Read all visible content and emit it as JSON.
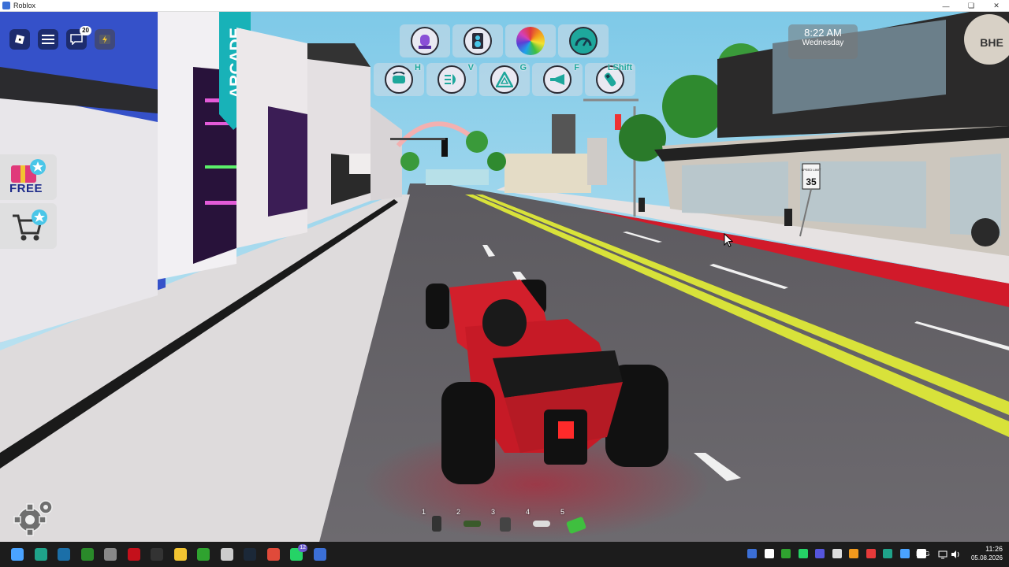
{
  "window": {
    "title": "Roblox",
    "controls": [
      "minimize-icon",
      "maximize-icon",
      "close-icon"
    ]
  },
  "hud": {
    "top_left": {
      "roblox_menu_icon": "roblox-logo-icon",
      "menu_icon": "hamburger-icon",
      "chat_badge": "20",
      "chat_icon": "chat-icon",
      "extra_icon": "lightning-icon"
    },
    "side_buttons": [
      {
        "name": "free-gift-button",
        "label": "FREE",
        "icon": "gift-star-icon"
      },
      {
        "name": "shop-button",
        "label": "",
        "icon": "cart-star-icon"
      }
    ],
    "vehicle_toolbar_row1": [
      {
        "name": "siren-button",
        "icon": "siren-icon",
        "color": "#8a4fd6"
      },
      {
        "name": "speaker-button",
        "icon": "speaker-icon",
        "color": "#2b2b3a"
      },
      {
        "name": "color-wheel-button",
        "icon": "color-wheel-icon",
        "color": "#f0b000"
      },
      {
        "name": "speedometer-button",
        "icon": "speedometer-icon",
        "color": "#1ea79c"
      }
    ],
    "vehicle_toolbar_row2": [
      {
        "name": "hazard-flip-button",
        "icon": "car-flip-icon",
        "key": "H"
      },
      {
        "name": "headlights-button",
        "icon": "headlight-icon",
        "key": "V"
      },
      {
        "name": "hazard-lights-button",
        "icon": "hazard-triangle-icon",
        "key": "G"
      },
      {
        "name": "horn-button",
        "icon": "horn-icon",
        "key": "F"
      },
      {
        "name": "boost-button",
        "icon": "nitro-icon",
        "key": "LShift"
      }
    ],
    "clock": {
      "time": "8:22 AM",
      "day": "Wednesday"
    },
    "hotbar": [
      {
        "slot": "1",
        "icon": "phone-icon",
        "color": "#333333"
      },
      {
        "slot": "2",
        "icon": "tool-icon",
        "color": "#3a5a2a"
      },
      {
        "slot": "3",
        "icon": "card-icon",
        "color": "#444444"
      },
      {
        "slot": "4",
        "icon": "car-key-icon",
        "color": "#dddddd"
      },
      {
        "slot": "5",
        "icon": "cash-icon",
        "color": "#3fbf3f"
      }
    ],
    "settings_icon": "gear-icon"
  },
  "scene": {
    "storefront_sign": "ARCADE",
    "speed_limit_sign_title": "SPEED LIMIT",
    "speed_limit_sign_value": "35",
    "building_logo": "BHE"
  },
  "taskbar": {
    "apps": [
      {
        "name": "start",
        "icon": "windows-icon",
        "color": "#4aa3ff"
      },
      {
        "name": "edge",
        "icon": "edge-icon",
        "color": "#1fa38a"
      },
      {
        "name": "app3",
        "icon": "bookmark-icon",
        "color": "#1b6fa8"
      },
      {
        "name": "xbox",
        "icon": "xbox-icon",
        "color": "#2a8a2a"
      },
      {
        "name": "app5",
        "icon": "steam-like-icon",
        "color": "#888888"
      },
      {
        "name": "netflix",
        "icon": "netflix-icon",
        "color": "#c4101b"
      },
      {
        "name": "epic",
        "icon": "epic-games-icon",
        "color": "#333333"
      },
      {
        "name": "explorer",
        "icon": "folder-icon",
        "color": "#f2c431"
      },
      {
        "name": "xbox2",
        "icon": "xbox-icon",
        "color": "#2fa32f"
      },
      {
        "name": "app10",
        "icon": "target-icon",
        "color": "#cccccc"
      },
      {
        "name": "steam",
        "icon": "steam-icon",
        "color": "#1b2838"
      },
      {
        "name": "chrome",
        "icon": "chrome-icon",
        "color": "#e04a3a"
      },
      {
        "name": "whatsapp",
        "icon": "whatsapp-icon",
        "color": "#25d366"
      },
      {
        "name": "roblox",
        "icon": "roblox-icon",
        "color": "#3b6fd6"
      }
    ],
    "whatsapp_badge": "12",
    "tray_icons": [
      {
        "icon": "roblox-tray-icon",
        "color": "#3b6fd6"
      },
      {
        "icon": "tray-app-icon",
        "color": "#ffffff"
      },
      {
        "icon": "xbox-tray-icon",
        "color": "#2fa32f"
      },
      {
        "icon": "whatsapp-tray-icon",
        "color": "#25d366"
      },
      {
        "icon": "tray-app2-icon",
        "color": "#5555dd"
      },
      {
        "icon": "tray-app3-icon",
        "color": "#dddddd"
      },
      {
        "icon": "tray-app4-icon",
        "color": "#f29a1c"
      },
      {
        "icon": "tray-app5-icon",
        "color": "#e63a3a"
      },
      {
        "icon": "tray-app6-icon",
        "color": "#1fa38a"
      },
      {
        "icon": "tray-app7-icon",
        "color": "#4aa3ff"
      },
      {
        "icon": "cloud-icon",
        "color": "#ffffff"
      }
    ],
    "language": "ENG",
    "time": "11:26",
    "date": "05.08.2026"
  }
}
